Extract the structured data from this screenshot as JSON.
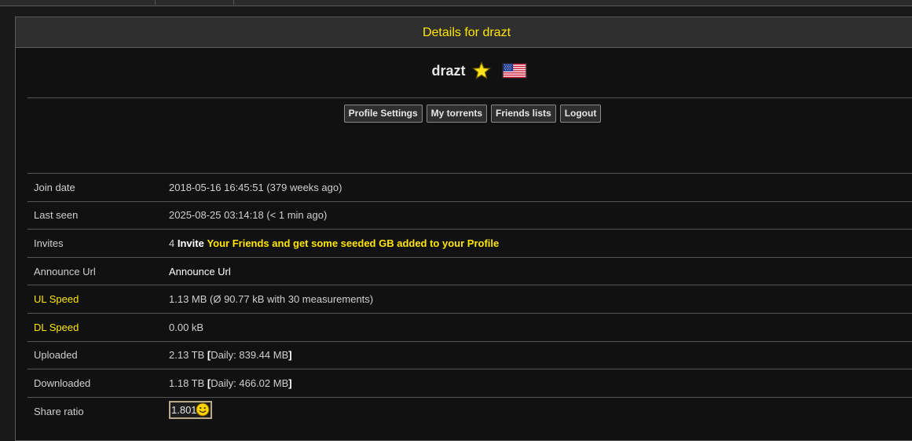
{
  "panel": {
    "title": "Details for drazt"
  },
  "profile": {
    "username": "drazt",
    "badge_icon": "star-icon",
    "flag_icon": "us-flag-icon"
  },
  "buttons": {
    "profile_settings": "Profile Settings",
    "my_torrents": "My torrents",
    "friends_lists": "Friends lists",
    "logout": "Logout"
  },
  "details": {
    "join_date": {
      "label": "Join date",
      "value": "2018-05-16 16:45:51 (379 weeks ago)"
    },
    "last_seen": {
      "label": "Last seen",
      "value": "2025-08-25 03:14:18 (< 1 min ago)"
    },
    "invites": {
      "label": "Invites",
      "count": "4",
      "invite_word": "Invite",
      "link_text": "Your Friends and get some seeded GB added to your Profile"
    },
    "announce_url": {
      "label": "Announce Url",
      "value": "Announce Url"
    },
    "ul_speed": {
      "label": "UL Speed",
      "value": "1.13 MB (Ø 90.77 kB with 30 measurements)"
    },
    "dl_speed": {
      "label": "DL Speed",
      "value": "0.00 kB"
    },
    "uploaded": {
      "label": "Uploaded",
      "total": "2.13 TB",
      "daily": "Daily: 839.44 MB"
    },
    "downloaded": {
      "label": "Downloaded",
      "total": "1.18 TB",
      "daily": "Daily: 466.02 MB"
    },
    "share_ratio": {
      "label": "Share ratio",
      "value": "1.801",
      "icon": "smiley-icon"
    }
  },
  "colors": {
    "accent": "#ffe600",
    "background": "#111111",
    "header": "#2f2f2f"
  }
}
